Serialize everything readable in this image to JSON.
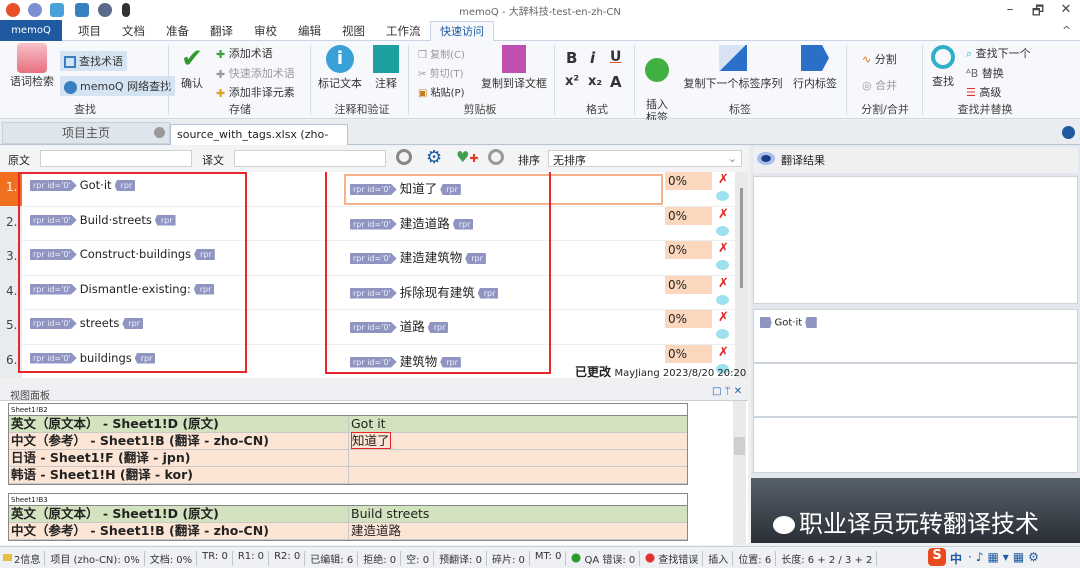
{
  "window": {
    "title": "memoQ - 大辞科技-test-en-zh-CN",
    "minimize": "–",
    "restore": "🗗",
    "close": "✕"
  },
  "menu": {
    "app": "memoQ",
    "tabs": [
      "项目",
      "文档",
      "准备",
      "翻译",
      "审校",
      "编辑",
      "视图",
      "工作流"
    ],
    "active": "快速访问",
    "collapse": "^"
  },
  "ribbon": {
    "find": {
      "term_lookup": "语词检索",
      "find_term": "查找术语",
      "web_search": "memoQ 网络查找",
      "group": "查找"
    },
    "store": {
      "confirm": "确认",
      "add_term": "添加术语",
      "quick_add_term": "快速添加术语",
      "add_nontrans": "添加非译元素",
      "group": "存储"
    },
    "comment": {
      "mark_text": "标记文本",
      "comment": "注释",
      "group": "注释和验证"
    },
    "clipboard": {
      "copy": "复制(C)",
      "cut": "剪切(T)",
      "paste": "粘贴(P)",
      "copy_to_target": "复制到译文框",
      "group": "剪贴板"
    },
    "format": {
      "bold": "B",
      "italic": "i",
      "underline": "U",
      "sup": "x²",
      "sub": "x₂",
      "group": "格式"
    },
    "tags": {
      "insert": "插入\n标签",
      "copy_next": "复制下一个标签序列",
      "inline": "行内标签",
      "group": "标签"
    },
    "split": {
      "split": "分割",
      "join": "合并",
      "group": "分割/合并"
    },
    "search": {
      "find": "查找",
      "find_next": "查找下一个",
      "replace": "替换",
      "advanced": "高级",
      "group": "查找并替换"
    }
  },
  "doc_tabs": {
    "home": "项目主页",
    "file": "source_with_tags.xlsx (zho-CN)",
    "close": "×"
  },
  "filter": {
    "source_label": "原文",
    "source_value": "",
    "target_label": "译文",
    "target_value": "",
    "sort_label": "排序",
    "sort_value": "无排序"
  },
  "grid": {
    "tag_open": "rpr id='0'",
    "tag_close": "rpr",
    "rows": [
      {
        "num": "1.",
        "source": "Got·it",
        "target": "知道了",
        "match": "0%"
      },
      {
        "num": "2.",
        "source": "Build·streets",
        "target": "建造道路",
        "match": "0%"
      },
      {
        "num": "3.",
        "source": "Construct·buildings",
        "target": "建造建筑物",
        "match": "0%"
      },
      {
        "num": "4.",
        "source": "Dismantle·existing:",
        "target": "拆除现有建筑",
        "match": "0%"
      },
      {
        "num": "5.",
        "source": "streets",
        "target": "道路",
        "match": "0%"
      },
      {
        "num": "6.",
        "source": "buildings",
        "target": "建筑物",
        "match": "0%"
      }
    ],
    "status": "已更改",
    "author": "MayJiang 2023/8/20 20:20"
  },
  "view_pane": {
    "title": "视图面板",
    "controls": "□ ᛘ ✕",
    "blocks": [
      {
        "caption": "Sheet1!B2",
        "rows": [
          {
            "label": "英文（原文本） - Sheet1!D (原文)",
            "value": "Got it",
            "type": "g"
          },
          {
            "label": "中文（参考） - Sheet1!B (翻译 - zho-CN)",
            "value": "知道了",
            "type": "o"
          },
          {
            "label": "日语 - Sheet1!F (翻译 - jpn)",
            "value": "",
            "type": "o"
          },
          {
            "label": "韩语 - Sheet1!H (翻译 - kor)",
            "value": "",
            "type": "o"
          }
        ]
      },
      {
        "caption": "Sheet1!B3",
        "rows": [
          {
            "label": "英文（原文本） - Sheet1!D (原文)",
            "value": "Build streets",
            "type": "g"
          },
          {
            "label": "中文（参考） - Sheet1!B (翻译 - zho-CN)",
            "value": "建造道路",
            "type": "o"
          }
        ]
      }
    ]
  },
  "right_panel": {
    "title": "翻译结果",
    "source_preview": "Got·it",
    "watermark": "职业译员玩转翻译技术"
  },
  "statusbar": {
    "items": [
      "2信息",
      "项目 (zho-CN): 0%",
      "文档: 0%",
      "TR: 0",
      "R1: 0",
      "R2: 0",
      "已编辑: 6",
      "拒绝: 0",
      "空: 0",
      "预翻译: 0",
      "碎片: 0",
      "MT: 0",
      "QA 错误: 0",
      "查找错误",
      "插入",
      "位置: 6",
      "长度: 6 + 2 / 3 + 2"
    ],
    "ime": "中"
  },
  "colors": {
    "accent": "#f07020",
    "brand": "#1f5aa0",
    "highlight": "#e8272a",
    "match_bg": "#fbd8bd"
  }
}
